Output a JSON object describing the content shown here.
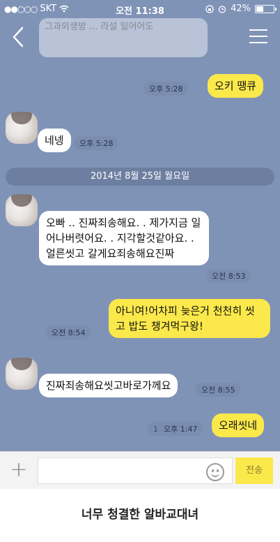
{
  "status_bar": {
    "carrier": "SKT",
    "time": "오전 11:38",
    "battery": "42%",
    "signal_dots": "●●○○○"
  },
  "header": {
    "back_icon": "chevron-left-icon",
    "menu_icon": "hamburger-menu-icon"
  },
  "ghost_message": {
    "text": "그과외생방 ... 라설\n일어어도"
  },
  "messages": [
    {
      "from": "me",
      "text": "오키 땡큐",
      "time": "오후 5:28"
    },
    {
      "from": "other",
      "text": "네넹",
      "time": "오후 5:28"
    },
    {
      "from": "other",
      "text": "오빠 .. 진짜죄송해요. . 제가지금 일어나버렷어요. .  지각할것같아요. . 얼른씻고 갈게요죄송해요진짜",
      "time": "오전 8:53"
    },
    {
      "from": "me",
      "text": "아니여!어차피 늦은거 천천히 씻고 밥도 챙겨먹구왕!",
      "time": "오전 8:54"
    },
    {
      "from": "other",
      "text": "진짜죄송해요씻고바로가께요",
      "time": "오전 8:55"
    },
    {
      "from": "me",
      "text": "오래씻네",
      "time": "오후 1:47",
      "unread": "1"
    }
  ],
  "date_divider": "2014년 8월 25일 월요일",
  "input_bar": {
    "send_label": "전송",
    "plus_icon": "plus-icon",
    "emoji_icon": "emoji-icon"
  },
  "caption": "너무 청결한 알바교대녀",
  "colors": {
    "chat_bg": "#7f93b7",
    "my_bubble": "#fbe84b",
    "other_bubble": "#ffffff"
  }
}
